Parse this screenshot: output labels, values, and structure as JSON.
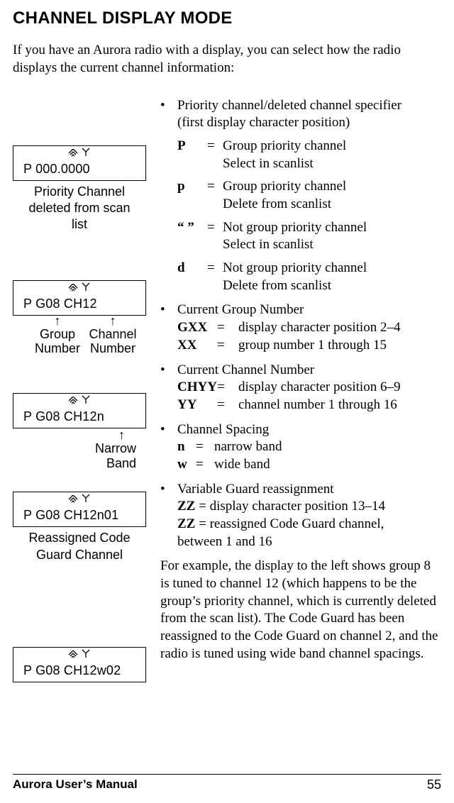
{
  "title": "CHANNEL DISPLAY MODE",
  "intro": "If you have an Aurora radio with a display, you can select how the radio displays the current channel information:",
  "lcd1": {
    "text": "P 000.0000",
    "label1": "Priority Channel",
    "label2": "deleted from scan",
    "label3": "list"
  },
  "lcd2": {
    "text": "P G08 CH12",
    "labelLeft1": "Group",
    "labelLeft2": "Number",
    "labelRight1": "Channel",
    "labelRight2": "Number"
  },
  "lcd3": {
    "text": "P G08  CH12n",
    "label1": "Narrow",
    "label2": "Band"
  },
  "lcd4": {
    "text": "P G08  CH12n01",
    "label1": "Reassigned Code",
    "label2": "Guard Channel"
  },
  "lcd5": {
    "text": "P G08 CH12w02"
  },
  "bullet1": {
    "intro1": "Priority channel/deleted channel specifier",
    "intro2": "(first display character position)",
    "r1sym": "P",
    "r1txt1": "Group priority channel",
    "r1txt2": "Select in scanlist",
    "r2sym": "p",
    "r2txt1": "Group priority channel",
    "r2txt2": "Delete from scanlist",
    "r3sym": "“ ”",
    "r3txt1": "Not group priority channel",
    "r3txt2": "Select in scanlist",
    "r4sym": "d",
    "r4txt1": "Not group priority channel",
    "r4txt2": "Delete from scanlist"
  },
  "bullet2": {
    "title": "Current Group Number",
    "s1": "GXX",
    "t1": "display character position 2–4",
    "s2": "XX",
    "t2": "group number 1 through 15"
  },
  "bullet3": {
    "title": "Current Channel Number",
    "s1": "CHYY",
    "t1": "display character position 6–9",
    "s2": "YY",
    "t2": "channel number 1 through 16"
  },
  "bullet4": {
    "title": "Channel Spacing",
    "s1": "n",
    "t1": "narrow band",
    "s2": "w",
    "t2": "wide band"
  },
  "bullet5": {
    "title": "Variable Guard reassignment",
    "s1": "ZZ",
    "t1": "display character position 13–14",
    "s2": "ZZ",
    "t2": "reassigned Code Guard channel,",
    "t3": "between 1 and 16"
  },
  "example": "For example, the display to the left shows group 8 is tuned to channel 12 (which happens to be the group’s priority channel, which is currently deleted from the scan list). The Code Guard has been reassigned to the Code Guard on channel 2, and the radio is tuned using wide band channel spacings.",
  "footer": {
    "left": "Aurora User’s Manual",
    "right": "55"
  },
  "glyphs": {
    "bullet": "•",
    "eq": "=",
    "arrowUp": "↑"
  }
}
